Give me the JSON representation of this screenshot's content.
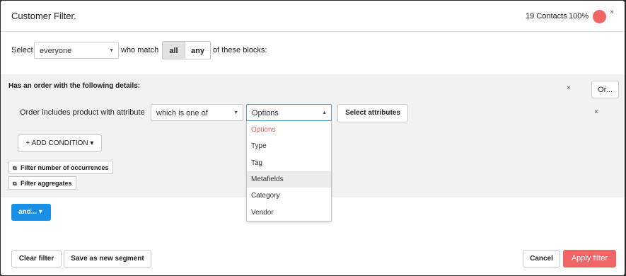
{
  "header": {
    "title": "Customer Filter.",
    "contacts": "19 Contacts",
    "percent": "100%",
    "close": "×",
    "status_color": "#f06565"
  },
  "select_row": {
    "select_label": "Select",
    "audience": "everyone",
    "who_match_label": "who match",
    "match_all": "all",
    "match_any": "any",
    "active_match": "all",
    "blocks_label": "of these blocks:"
  },
  "block": {
    "title": "Has an order with the following details:",
    "remove": "×",
    "or_button": "Or...",
    "condition": {
      "label": "Order includes product with attribute",
      "operator": "which is one of",
      "attribute": "Options",
      "select_attributes": "Select attributes",
      "remove": "×"
    },
    "add_condition": "+ ADD CONDITION ▾",
    "filter_occurrences": "Filter number of occurrences",
    "filter_aggregates": "Filter aggregates"
  },
  "dropdown": {
    "items": [
      "Options",
      "Type",
      "Tag",
      "Metafields",
      "Category",
      "Vendor"
    ],
    "selected": "Options",
    "hovered": "Metafields",
    "selected_color": "#f06565"
  },
  "and_button": "and... ▾",
  "footer": {
    "clear_filter": "Clear filter",
    "save_segment": "Save as new segment",
    "cancel": "Cancel",
    "apply": "Apply filter",
    "apply_color": "#f06566",
    "and_color": "#1a8fe6"
  }
}
